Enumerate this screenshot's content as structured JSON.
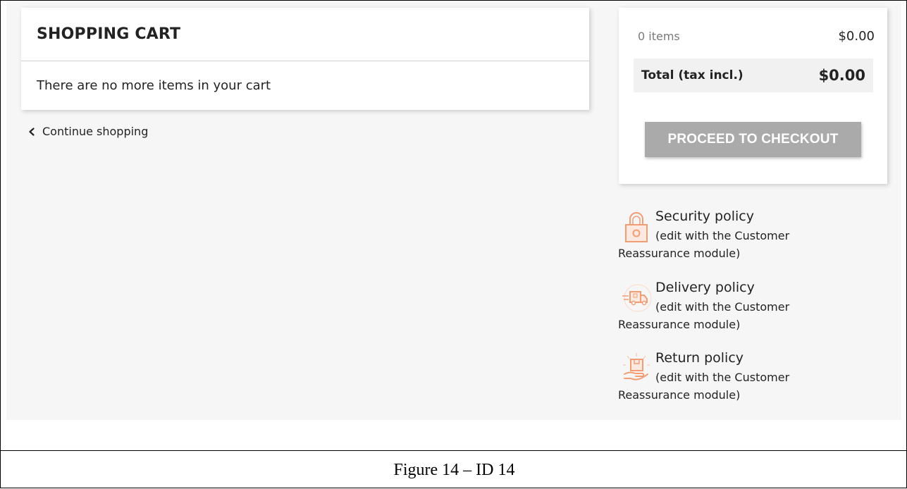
{
  "cart": {
    "title": "SHOPPING CART",
    "empty_message": "There are no more items in your cart",
    "continue_label": "Continue shopping"
  },
  "summary": {
    "items_label": "0 items",
    "items_amount": "$0.00",
    "total_label": "Total (tax incl.)",
    "total_amount": "$0.00",
    "checkout_label": "PROCEED TO CHECKOUT"
  },
  "reassurance": [
    {
      "icon": "lock-icon",
      "title": "Security policy",
      "desc": "(edit with the Customer Reassurance module)"
    },
    {
      "icon": "delivery-truck-icon",
      "title": "Delivery policy",
      "desc": "(edit with the Customer Reassurance module)"
    },
    {
      "icon": "return-package-icon",
      "title": "Return policy",
      "desc": "(edit with the Customer Reassurance module)"
    }
  ],
  "caption": "Figure 14 – ID  14",
  "colors": {
    "icon_accent": "#f19d76",
    "button_disabled": "#aaaaaa",
    "page_background": "#f6f6f6",
    "text": "#232323"
  }
}
